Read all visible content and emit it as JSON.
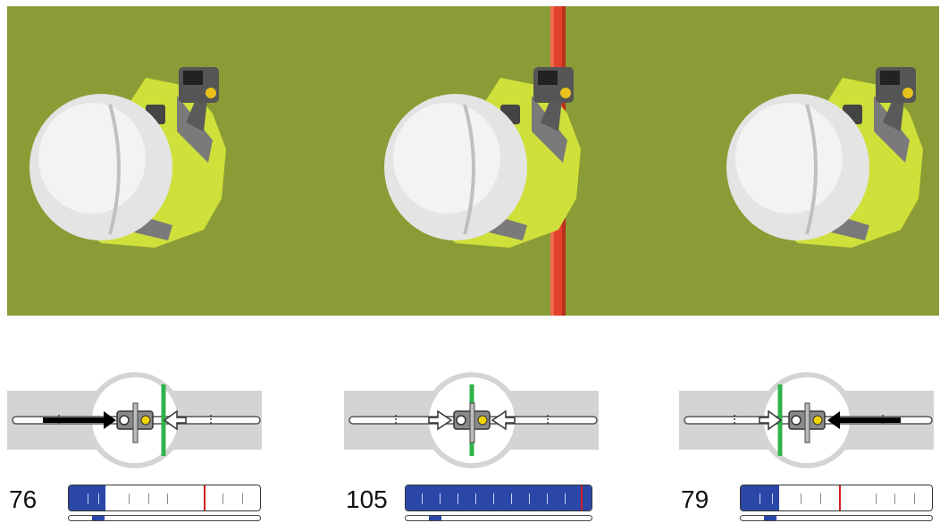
{
  "scene": {
    "colors": {
      "ground": "#8b9c36",
      "pipe": "#e2412b",
      "helmet": "#e8e8e8",
      "vest": "#cfe03a",
      "stripe": "#777777"
    }
  },
  "panels": [
    {
      "depth": "76",
      "signal_level": 0.19,
      "threshold": 0.7,
      "position_marker": 0.12,
      "arrow_direction": "right",
      "locate_line": "right"
    },
    {
      "depth": "105",
      "signal_level": 1.0,
      "threshold": 0.99,
      "position_marker": 0.12,
      "arrow_direction": "both",
      "locate_line": "center"
    },
    {
      "depth": "79",
      "signal_level": 0.2,
      "threshold": 0.5,
      "position_marker": 0.12,
      "arrow_direction": "left",
      "locate_line": "left"
    }
  ],
  "colors": {
    "signal_fill": "#2a47a8",
    "threshold": "#d02020",
    "locate_line": "#2fb34a",
    "gauge_bg": "#d4d4d4",
    "bulb": "#f0d400"
  }
}
